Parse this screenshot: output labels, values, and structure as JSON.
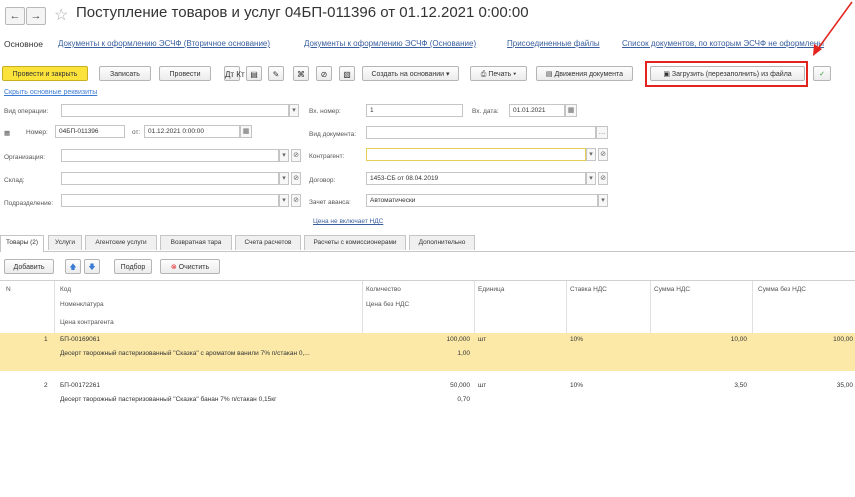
{
  "window": {
    "title": "Поступление товаров и услуг 04БП-011396 от 01.12.2021 0:00:00"
  },
  "nav": {
    "back": "←",
    "forward": "→",
    "star": "☆"
  },
  "top_tabs": [
    "Основное",
    "Документы к оформлению ЭСЧФ (Вторичное основание)",
    "Документы к оформлению ЭСЧФ (Основание)",
    "Присоединенные файлы",
    "Список документов, по которым ЭСЧФ не оформлены"
  ],
  "toolbar": {
    "post_close": "Провести и закрыть",
    "save": "Записать",
    "post": "Провести",
    "create_based": "Создать на основании",
    "print": "Печать",
    "movements": "Движения документа",
    "load_file": "Загрузить (перезаполнить) из файла",
    "check": "✓",
    "icon_labels": [
      "Дт Кт",
      "▤",
      "✎",
      "⌘",
      "⊘",
      "▧"
    ]
  },
  "link_basic": "Скрыть основные реквизиты",
  "form": {
    "op_type_label": "Вид операции:",
    "op_type_value": "",
    "in_number_label": "Вх. номер:",
    "in_number_value": "1",
    "in_date_label": "Вх. дата:",
    "in_date_value": "01.01.2021",
    "number_label": "Номер:",
    "number_value": "04БП-011396",
    "from_label": "от:",
    "date_value": "01.12.2021 0:00:00",
    "doc_type_label": "Вид документа:",
    "doc_type_value": "",
    "org_label": "Организация:",
    "org_value": "",
    "contractor_label": "Контрагент:",
    "contractor_value": "",
    "warehouse_label": "Склад:",
    "warehouse_value": "",
    "contract_label": "Договор:",
    "contract_value": "1453-СБ от 08.04.2019",
    "division_label": "Подразделение:",
    "division_value": "",
    "advance_label": "Зачет аванса:",
    "advance_value": "Автоматически",
    "vat_link": "Цена не включает НДС"
  },
  "tabs2": [
    "Товары (2)",
    "Услуги",
    "Агентские услуги",
    "Возвратная тара",
    "Счета расчетов",
    "Расчеты с комиссионерами",
    "Дополнительно"
  ],
  "table_toolbar": {
    "add": "Добавить",
    "up": "🡅",
    "down": "🡇",
    "selection": "Подбор",
    "clear": "Очистить"
  },
  "table": {
    "headers": {
      "n": "N",
      "code": "Код",
      "nomenclature": "Номенклатура",
      "counter_price": "Цена контрагента",
      "quantity": "Количество",
      "price_no_vat": "Цена без НДС",
      "unit": "Единица",
      "vat_rate": "Ставка НДС",
      "vat_sum": "Сумма НДС",
      "sum_no_vat": "Сумма без НДС"
    },
    "rows": [
      {
        "n": "1",
        "code": "БП-00169061",
        "name": "Десерт творожный пастеризованный \"Сказка\" с ароматом ванили 7% п/стакан 0,...",
        "quantity": "100,000",
        "price": "1,00",
        "unit": "шт",
        "vat_rate": "10%",
        "vat_sum": "10,00",
        "sum": "100,00"
      },
      {
        "n": "2",
        "code": "БП-00172261",
        "name": "Десерт творожный пастеризованный \"Сказка\" банан 7% п/стакан 0,15кг",
        "quantity": "50,000",
        "price": "0,70",
        "unit": "шт",
        "vat_rate": "10%",
        "vat_sum": "3,50",
        "sum": "35,00"
      }
    ]
  },
  "colors": {
    "accent_yellow": "#fbe33c",
    "annotation_red": "#e3231d",
    "link_blue": "#3a5f9e",
    "row_selected": "#fce9a8"
  }
}
